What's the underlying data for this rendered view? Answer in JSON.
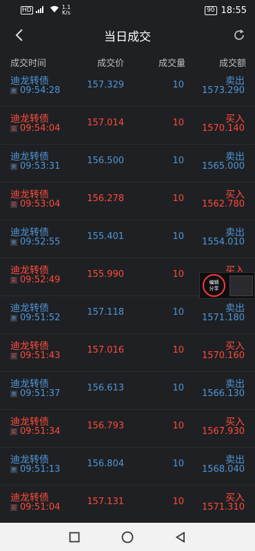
{
  "status_bar": {
    "left_label": "HD",
    "net_speed_top": "1.1",
    "net_speed_unit": "K/s",
    "battery": "90",
    "clock": "18:55"
  },
  "header": {
    "title": "当日成交"
  },
  "columns": {
    "time": "成交时间",
    "price": "成交价",
    "volume": "成交量",
    "amount": "成交额"
  },
  "rows": [
    {
      "name": "迪龙转债",
      "time": "09:54:28",
      "mark": "卖",
      "price": "157.329",
      "volume": "10",
      "dir": "卖出",
      "amount": "1573.290",
      "side": "sell"
    },
    {
      "name": "迪龙转债",
      "time": "09:54:04",
      "mark": "买",
      "price": "157.014",
      "volume": "10",
      "dir": "买入",
      "amount": "1570.140",
      "side": "buy"
    },
    {
      "name": "迪龙转债",
      "time": "09:53:31",
      "mark": "卖",
      "price": "156.500",
      "volume": "10",
      "dir": "卖出",
      "amount": "1565.000",
      "side": "sell"
    },
    {
      "name": "迪龙转债",
      "time": "09:53:04",
      "mark": "买",
      "price": "156.278",
      "volume": "10",
      "dir": "买入",
      "amount": "1562.780",
      "side": "buy"
    },
    {
      "name": "迪龙转债",
      "time": "09:52:55",
      "mark": "卖",
      "price": "155.401",
      "volume": "10",
      "dir": "卖出",
      "amount": "1554.010",
      "side": "sell"
    },
    {
      "name": "迪龙转债",
      "time": "09:52:49",
      "mark": "买",
      "price": "155.990",
      "volume": "10",
      "dir": "买入",
      "amount": "",
      "side": "buy"
    },
    {
      "name": "迪龙转债",
      "time": "09:51:52",
      "mark": "卖",
      "price": "157.118",
      "volume": "10",
      "dir": "卖出",
      "amount": "1571.180",
      "side": "sell"
    },
    {
      "name": "迪龙转债",
      "time": "09:51:43",
      "mark": "买",
      "price": "157.016",
      "volume": "10",
      "dir": "买入",
      "amount": "1570.160",
      "side": "buy"
    },
    {
      "name": "迪龙转债",
      "time": "09:51:37",
      "mark": "卖",
      "price": "156.613",
      "volume": "10",
      "dir": "卖出",
      "amount": "1566.130",
      "side": "sell"
    },
    {
      "name": "迪龙转债",
      "time": "09:51:34",
      "mark": "买",
      "price": "156.793",
      "volume": "10",
      "dir": "买入",
      "amount": "1567.930",
      "side": "buy"
    },
    {
      "name": "迪龙转债",
      "time": "09:51:13",
      "mark": "卖",
      "price": "156.804",
      "volume": "10",
      "dir": "卖出",
      "amount": "1568.040",
      "side": "sell"
    },
    {
      "name": "迪龙转债",
      "time": "09:51:04",
      "mark": "买",
      "price": "157.131",
      "volume": "10",
      "dir": "买入",
      "amount": "1571.310",
      "side": "buy"
    }
  ],
  "float_widget": {
    "label_line1": "编辑",
    "label_line2": "分享"
  },
  "colors": {
    "buy": "#ff4b3c",
    "sell": "#4f97d8",
    "background": "#1f2023"
  }
}
